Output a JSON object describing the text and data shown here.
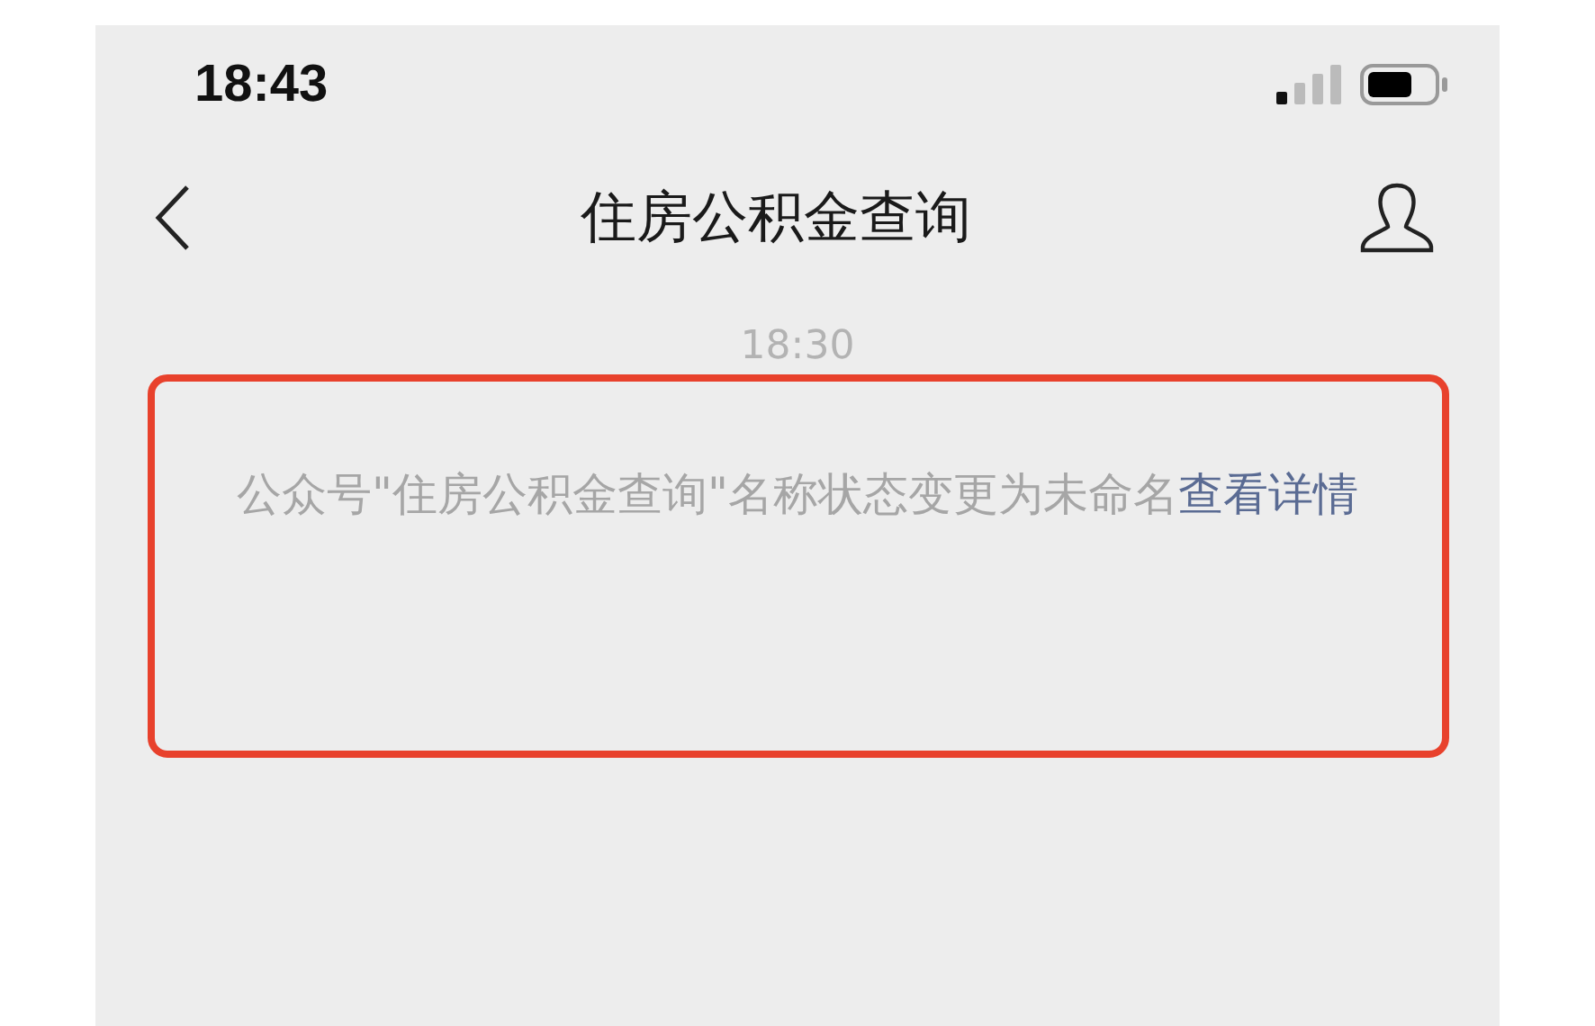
{
  "status_bar": {
    "time": "18:43"
  },
  "nav": {
    "title": "住房公积金查询"
  },
  "chat": {
    "timestamp": "18:30",
    "notice": {
      "text": "公众号\"住房公积金查询\"名称状态变更为未命名",
      "link": "查看详情"
    }
  }
}
